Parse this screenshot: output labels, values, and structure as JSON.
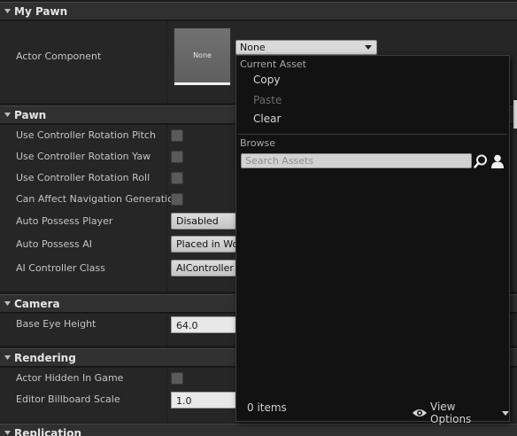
{
  "sections": {
    "my_pawn": "My Pawn",
    "pawn": "Pawn",
    "camera": "Camera",
    "rendering": "Rendering",
    "replication": "Replication"
  },
  "my_pawn": {
    "actor_component_label": "Actor Component",
    "thumbnail_text": "None",
    "asset_value": "None"
  },
  "pawn": {
    "rows": [
      {
        "label": "Use Controller Rotation Pitch"
      },
      {
        "label": "Use Controller Rotation Yaw"
      },
      {
        "label": "Use Controller Rotation Roll"
      },
      {
        "label": "Can Affect Navigation Generation"
      },
      {
        "label": "Auto Possess Player",
        "value": "Disabled"
      },
      {
        "label": "Auto Possess AI",
        "value": "Placed in World"
      },
      {
        "label": "AI Controller Class",
        "value": "AIController"
      }
    ]
  },
  "camera": {
    "base_eye_height_label": "Base Eye Height",
    "base_eye_height_value": "64.0"
  },
  "rendering": {
    "actor_hidden_label": "Actor Hidden In Game",
    "billboard_scale_label": "Editor Billboard Scale",
    "billboard_scale_value": "1.0"
  },
  "menu": {
    "current_asset_heading": "Current Asset",
    "copy": "Copy",
    "paste": "Paste",
    "clear": "Clear",
    "browse_heading": "Browse",
    "search_placeholder": "Search Assets",
    "items_count": "0 items",
    "view_options": "View Options"
  },
  "icons": {
    "search": "search-icon",
    "user": "user-icon",
    "eye": "eye-icon",
    "expand_arrow": "expand-arrow-icon"
  },
  "colors": {
    "header_bg": "#303030",
    "panel_bg": "#262626",
    "menu_bg": "#121212"
  }
}
